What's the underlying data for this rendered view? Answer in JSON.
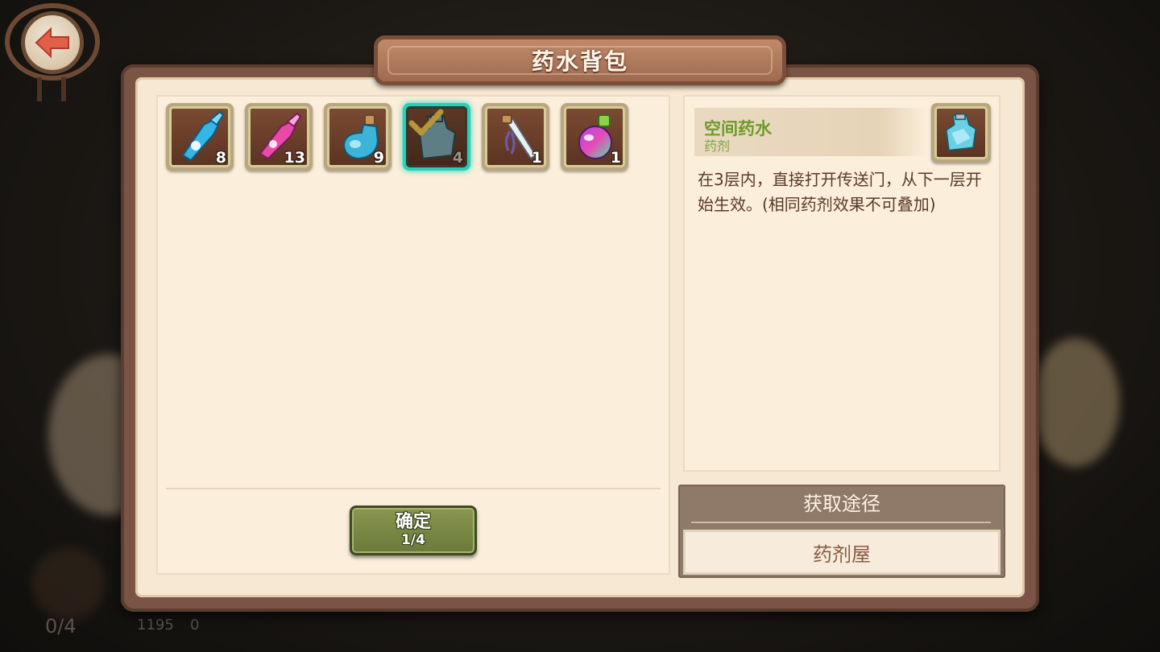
{
  "panel": {
    "title": "药水背包"
  },
  "inventory": [
    {
      "name": "blue-potion-icon",
      "count": "8",
      "selected": false
    },
    {
      "name": "pink-potion-icon",
      "count": "13",
      "selected": false
    },
    {
      "name": "flask-potion-icon",
      "count": "9",
      "selected": false
    },
    {
      "name": "space-potion-icon",
      "count": "4",
      "selected": true
    },
    {
      "name": "ribbon-vial-icon",
      "count": "1",
      "selected": false
    },
    {
      "name": "rainbow-potion-icon",
      "count": "1",
      "selected": false
    }
  ],
  "confirm": {
    "label": "确定",
    "progress": "1/4"
  },
  "detail": {
    "name": "空间药水",
    "type": "药剂",
    "description": "在3层内，直接打开传送门，从下一层开始生效。(相同药剂效果不可叠加)"
  },
  "source": {
    "title": "获取途径",
    "item": "药剂屋"
  },
  "background": {
    "stat_left": "0/4",
    "gold": "1195",
    "gem": "0"
  },
  "colors": {
    "selected_border": "#27d0b8",
    "item_name": "#6e9a2a",
    "confirm_button": "#7a8845"
  }
}
